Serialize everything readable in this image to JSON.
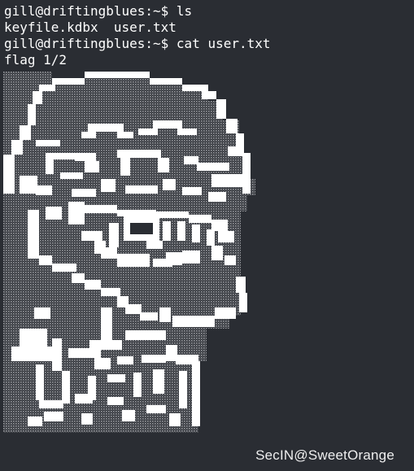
{
  "terminal": {
    "background": "#2a2d33",
    "foreground": "#ffffff",
    "lines": [
      "gill@driftingblues:~$ ls",
      "keyfile.kdbx  user.txt",
      "gill@driftingblues:~$ cat user.txt",
      "flag 1/2"
    ]
  },
  "ascii_art": {
    "subject": "troll-face",
    "colors": {
      "solid": "#ffffff",
      "dither": "#8f9196"
    }
  },
  "watermark": {
    "text": "SecIN@SweetOrange"
  }
}
